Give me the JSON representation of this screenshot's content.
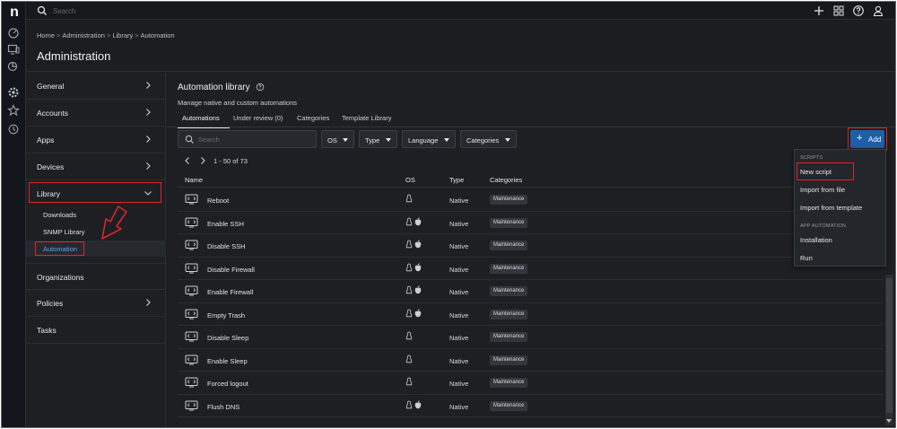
{
  "topbar": {
    "search_placeholder": "Search"
  },
  "header": {
    "breadcrumb": [
      "Home",
      "Administration",
      "Library",
      "Automation"
    ],
    "breadcrumb_sep": ">",
    "title": "Administration"
  },
  "sidebar": {
    "items": [
      {
        "label": "General",
        "chevron": "right"
      },
      {
        "label": "Accounts",
        "chevron": "right"
      },
      {
        "label": "Apps",
        "chevron": "right"
      },
      {
        "label": "Devices",
        "chevron": "right"
      },
      {
        "label": "Library",
        "chevron": "down"
      },
      {
        "label": "Organizations",
        "chevron": ""
      },
      {
        "label": "Policies",
        "chevron": "right"
      },
      {
        "label": "Tasks",
        "chevron": ""
      }
    ],
    "library_sub": [
      "Downloads",
      "SNMP Library",
      "Automation"
    ],
    "active_sub": "Automation"
  },
  "content": {
    "title": "Automation library",
    "subtitle": "Manage native and custom automations",
    "tabs": [
      "Automations",
      "Under review (0)",
      "Categories",
      "Template Library"
    ],
    "active_tab": "Automations",
    "search_placeholder": "Search",
    "filters": [
      "OS",
      "Type",
      "Language",
      "Categories"
    ],
    "add_label": "Add",
    "pager": "1 - 50 of 73",
    "columns": [
      "Name",
      "OS",
      "Type",
      "Categories"
    ],
    "rows": [
      {
        "name": "Reboot",
        "os": [
          "linux"
        ],
        "type": "Native",
        "category": "Maintenance"
      },
      {
        "name": "Enable SSH",
        "os": [
          "linux",
          "apple"
        ],
        "type": "Native",
        "category": "Maintenance"
      },
      {
        "name": "Disable SSH",
        "os": [
          "linux",
          "apple"
        ],
        "type": "Native",
        "category": "Maintenance"
      },
      {
        "name": "Disable Firewall",
        "os": [
          "linux",
          "apple"
        ],
        "type": "Native",
        "category": "Maintenance"
      },
      {
        "name": "Enable Firewall",
        "os": [
          "linux",
          "apple"
        ],
        "type": "Native",
        "category": "Maintenance"
      },
      {
        "name": "Empty Trash",
        "os": [
          "linux",
          "apple"
        ],
        "type": "Native",
        "category": "Maintenance"
      },
      {
        "name": "Disable Sleep",
        "os": [
          "linux"
        ],
        "type": "Native",
        "category": "Maintenance"
      },
      {
        "name": "Enable Sleep",
        "os": [
          "linux"
        ],
        "type": "Native",
        "category": "Maintenance"
      },
      {
        "name": "Forced logout",
        "os": [
          "linux"
        ],
        "type": "Native",
        "category": "Maintenance"
      },
      {
        "name": "Flush DNS",
        "os": [
          "linux",
          "apple"
        ],
        "type": "Native",
        "category": "Maintenance"
      }
    ]
  },
  "add_menu": {
    "sections": [
      {
        "header": "SCRIPTS",
        "items": [
          "New script",
          "Import from file",
          "Import from template"
        ]
      },
      {
        "header": "APP AUTOMATION",
        "items": [
          "Installation",
          "Run"
        ]
      }
    ],
    "highlighted": "New script"
  },
  "colors": {
    "accent": "#1f5fa8",
    "highlight": "#d9262c",
    "background": "#1d1f23"
  }
}
